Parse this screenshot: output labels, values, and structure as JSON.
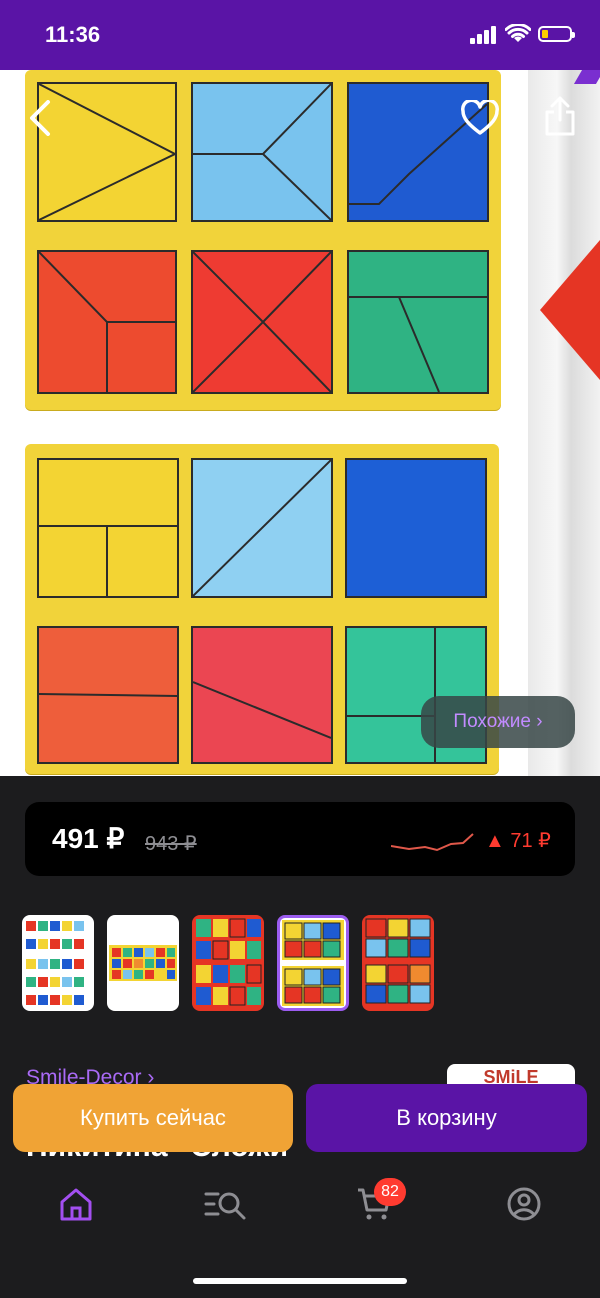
{
  "status_bar": {
    "time": "11:36"
  },
  "product": {
    "similar_label": "Похожие ›",
    "price": "491 ₽",
    "old_price": "943 ₽",
    "price_change": "▲ 71 ₽",
    "seller": "Smile-Decor ›",
    "seller_logo_text": "SMiLE",
    "title": "Никитина \"Сложи"
  },
  "actions": {
    "buy_now": "Купить сейчас",
    "add_to_cart": "В корзину"
  },
  "tabbar": {
    "cart_badge": "82",
    "items": [
      "home-icon",
      "catalog-search-icon",
      "cart-icon",
      "profile-icon"
    ]
  },
  "colors": {
    "brand_purple": "#5a14a6",
    "accent_orange": "#f0a335",
    "price_up_red": "#ff3b30",
    "link_purple": "#a96af5"
  }
}
